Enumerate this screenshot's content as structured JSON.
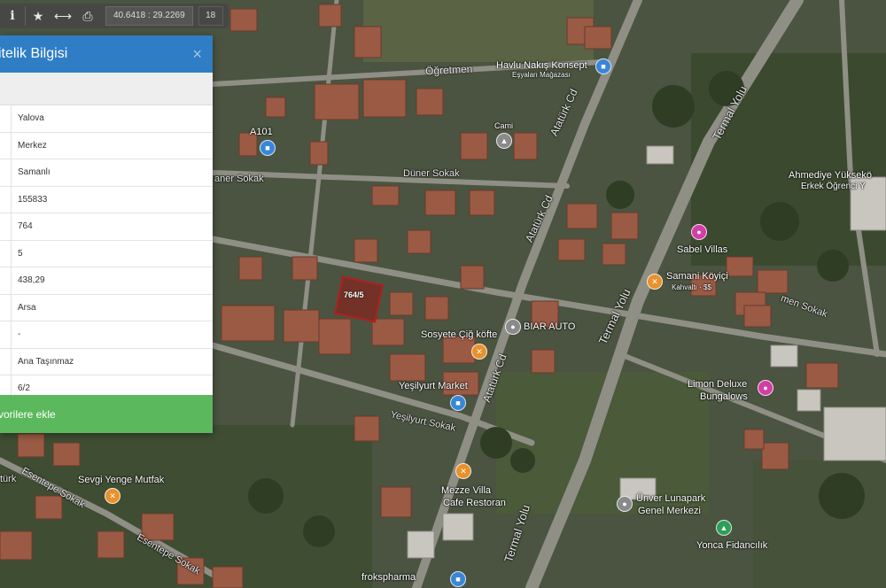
{
  "toolbar": {
    "info_icon": "info-icon",
    "star_icon": "star-icon",
    "measure_icon": "measure-icon",
    "print_icon": "print-icon",
    "coordinates": "40.6418 : 29.2269",
    "zoom": "18"
  },
  "panel": {
    "title": "itelik Bilgisi",
    "close": "×",
    "rows": [
      "Yalova",
      "Merkez",
      "Samanlı",
      "155833",
      "764",
      "5",
      "438,29",
      "Arsa",
      "-",
      "Ana Taşınmaz",
      "6/2"
    ],
    "favorite_button": "vorilere ekle"
  },
  "map": {
    "parcel_label": "764/5",
    "roads": {
      "ogretmen": "Öğretmen",
      "duner": "Düner Sokak",
      "aner": "aner Sokak",
      "ataturk1": "Atatürk Cd",
      "ataturk2": "Atatürk Cd",
      "ataturk3": "Atatürk Cd",
      "termal1": "Termal Yolu",
      "termal2": "Termal Yolu",
      "termal3": "Termal Yolu",
      "yesilyurt": "Yeşilyurt Sokak",
      "esentepe1": "Esentepe Sokak",
      "esentepe2": "Esentepe Sokak",
      "sonu": "men Sokak",
      "ataturk_left": "türk"
    },
    "pois": {
      "havlu": "Havlu Nakış Konsept",
      "havlu_sub": "Eşyaları Mağazası",
      "cami": "Cami",
      "a101": "A101",
      "ahmediye": "Ahmediye Yüksekö",
      "ahmediye_sub": "Erkek Öğrenci Y",
      "sabel": "Sabel Villas",
      "samani": "Samani Köyiçi",
      "samani_sub": "Kahvaltı · $$",
      "biar": "BIAR AUTO",
      "sosyete": "Sosyete Çiğ köfte",
      "yesilyurt_market": "Yeşilyurt Market",
      "limon": "Limon Deluxe",
      "limon_sub": "Bungalows",
      "sevgi": "Sevgi Yenge Mutfak",
      "mezze": "Mezze Villa",
      "mezze_sub": "Cafe Restoran",
      "univer": "Ünver Lunapark",
      "univer_sub": "Genel Merkezi",
      "yonca": "Yonca Fidancılık",
      "froks": "frokspharma"
    },
    "colors": {
      "shop_pin": "#3a86d6",
      "food_pin": "#e8912d",
      "hotel_pin": "#d13fa6",
      "place_pin": "#8a8a8a",
      "park_pin": "#2e9e57",
      "parcel": "#b02020"
    }
  }
}
